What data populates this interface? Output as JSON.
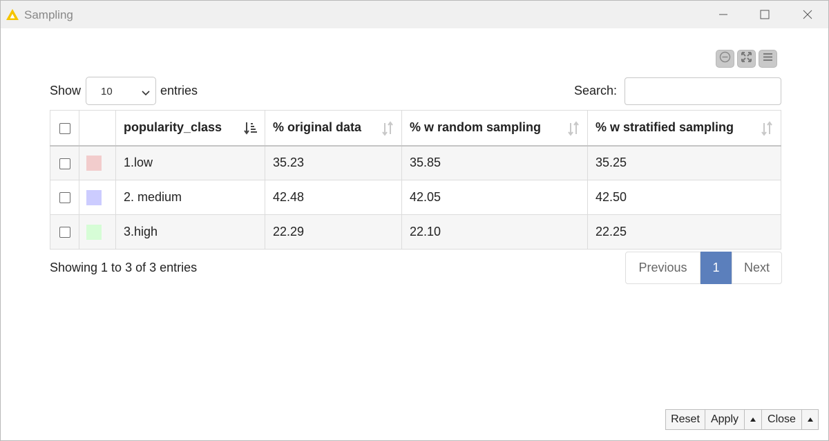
{
  "window": {
    "title": "Sampling",
    "controls": {
      "minimize": "minimize-icon",
      "maximize": "maximize-icon",
      "close": "close-icon"
    }
  },
  "view_toolbar": {
    "icons": [
      "collapse-icon",
      "fullscreen-icon",
      "menu-icon"
    ]
  },
  "length_menu": {
    "show_label": "Show",
    "value": "10",
    "entries_label": "entries"
  },
  "search": {
    "label": "Search:",
    "value": "",
    "placeholder": ""
  },
  "table": {
    "columns": [
      "popularity_class",
      "% original data",
      "% w random sampling",
      "% w stratified sampling"
    ],
    "rows": [
      {
        "class": "1.low",
        "color": "#f2cccc",
        "original": "35.23",
        "random": "35.85",
        "stratified": "35.25"
      },
      {
        "class": "2. medium",
        "color": "#ccccff",
        "original": "42.48",
        "random": "42.05",
        "stratified": "42.50"
      },
      {
        "class": "3.high",
        "color": "#d6fdd6",
        "original": "22.29",
        "random": "22.10",
        "stratified": "22.25"
      }
    ]
  },
  "info": "Showing 1 to 3 of 3 entries",
  "pagination": {
    "previous": "Previous",
    "current": "1",
    "next": "Next"
  },
  "footer": {
    "reset": "Reset",
    "apply": "Apply",
    "close": "Close"
  },
  "colors": {
    "accent": "#5b7fbc",
    "title_bar": "#f0f0f0",
    "warning_icon": "#f5c400"
  }
}
